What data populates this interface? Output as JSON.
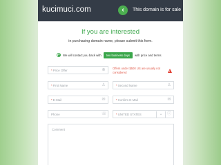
{
  "header": {
    "domain": "kucimuci.com",
    "back_glyph": "‹",
    "sale_text": "This domain is for sale"
  },
  "form": {
    "heading": "If you are interested",
    "subheading": "in purchasing domain name, please submit this form.",
    "contact_prefix": "We will contact you back with",
    "contact_pill": "two business days",
    "contact_suffix": "with price and terms",
    "price_offer_placeholder": "Price Offer",
    "price_error": "Offers under $500 US are usually not considered",
    "first_name_placeholder": "First Name",
    "second_name_placeholder": "Second Name",
    "email_placeholder": "E-Mail",
    "confirm_email_placeholder": "Confirm E-Mail",
    "phone_placeholder": "Phone",
    "country_value": "UNITED STATES",
    "comment_placeholder": "Comment"
  },
  "icons": {
    "price": "circle-x-icon",
    "first_name": "person-icon",
    "second_name": "person-icon",
    "email": "envelope-icon",
    "confirm_email": "envelope-icon",
    "phone": "phone-icon",
    "country_toggle": "chevron-down-icon",
    "country_info": "info-icon",
    "warning": "warning-icon"
  },
  "colors": {
    "accent": "#3aa64a",
    "header_bg": "#343c47",
    "error": "#e05a4a"
  }
}
